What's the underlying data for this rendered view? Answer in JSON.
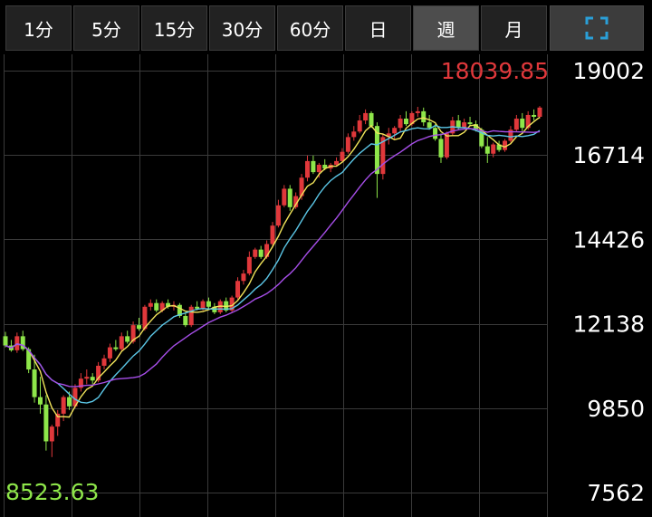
{
  "tabs": [
    {
      "label": "1分",
      "active": false
    },
    {
      "label": "5分",
      "active": false
    },
    {
      "label": "15分",
      "active": false
    },
    {
      "label": "30分",
      "active": false
    },
    {
      "label": "60分",
      "active": false
    },
    {
      "label": "日",
      "active": false
    },
    {
      "label": "週",
      "active": true
    },
    {
      "label": "月",
      "active": false
    }
  ],
  "fullscreen_icon": "expand-icon",
  "colors": {
    "up": "#e0383b",
    "down": "#8ee64a",
    "ma_short": "#f2e45a",
    "ma_mid": "#5bc6e6",
    "ma_long": "#a64ee8",
    "grid": "#3a3a3a",
    "axis_text": "#ffffff",
    "max_label": "#e0383b",
    "min_label": "#8ee64a",
    "active_tab": "#4d4d4d"
  },
  "chart_data": {
    "type": "candlestick",
    "period": "週",
    "y_ticks": [
      "19002",
      "16714",
      "14426",
      "12138",
      "9850",
      "7562"
    ],
    "ylim": [
      7562,
      19002
    ],
    "high_label": "18039.85",
    "low_label": "8523.63",
    "grid": true,
    "moving_averages": [
      "short",
      "mid",
      "long"
    ],
    "candles": [
      [
        11800,
        11920,
        11500,
        11550
      ],
      [
        11550,
        11700,
        11380,
        11420
      ],
      [
        11420,
        11900,
        11350,
        11800
      ],
      [
        11800,
        11950,
        11400,
        11450
      ],
      [
        11450,
        11500,
        10800,
        10900
      ],
      [
        10900,
        11300,
        10000,
        10150
      ],
      [
        10150,
        10700,
        9700,
        9950
      ],
      [
        9950,
        10200,
        8700,
        8950
      ],
      [
        8950,
        9400,
        8524,
        9350
      ],
      [
        9350,
        9800,
        9100,
        9700
      ],
      [
        9700,
        10200,
        9500,
        10150
      ],
      [
        10150,
        10300,
        9800,
        9900
      ],
      [
        9900,
        10500,
        9850,
        10400
      ],
      [
        10400,
        10800,
        10300,
        10650
      ],
      [
        10650,
        10900,
        10500,
        10700
      ],
      [
        10700,
        10800,
        10500,
        10600
      ],
      [
        10600,
        11100,
        10550,
        11000
      ],
      [
        11000,
        11300,
        10900,
        11200
      ],
      [
        11200,
        11600,
        11100,
        11500
      ],
      [
        11500,
        11700,
        11400,
        11450
      ],
      [
        11450,
        11900,
        11400,
        11800
      ],
      [
        11800,
        11950,
        11600,
        11650
      ],
      [
        11650,
        12200,
        11600,
        12100
      ],
      [
        12100,
        12300,
        11950,
        12000
      ],
      [
        12000,
        12650,
        11950,
        12600
      ],
      [
        12600,
        12800,
        12500,
        12700
      ],
      [
        12700,
        12800,
        12450,
        12500
      ],
      [
        12500,
        12750,
        12450,
        12700
      ],
      [
        12700,
        12800,
        12550,
        12600
      ],
      [
        12600,
        12750,
        12500,
        12650
      ],
      [
        12650,
        12700,
        12300,
        12350
      ],
      [
        12350,
        12450,
        12050,
        12100
      ],
      [
        12100,
        12650,
        12050,
        12600
      ],
      [
        12600,
        12750,
        12500,
        12550
      ],
      [
        12550,
        12800,
        12500,
        12750
      ],
      [
        12750,
        12850,
        12550,
        12600
      ],
      [
        12600,
        12700,
        12400,
        12450
      ],
      [
        12450,
        12800,
        12400,
        12750
      ],
      [
        12750,
        12850,
        12450,
        12500
      ],
      [
        12500,
        12900,
        12450,
        12850
      ],
      [
        12850,
        13400,
        12800,
        13300
      ],
      [
        13300,
        13600,
        13200,
        13500
      ],
      [
        13500,
        14100,
        13450,
        13950
      ],
      [
        13950,
        14200,
        13900,
        14150
      ],
      [
        14150,
        14250,
        13900,
        13950
      ],
      [
        13950,
        14400,
        13900,
        14300
      ],
      [
        14300,
        14900,
        14200,
        14800
      ],
      [
        14800,
        15500,
        14750,
        15350
      ],
      [
        15350,
        15900,
        15300,
        15800
      ],
      [
        15800,
        15900,
        15200,
        15300
      ],
      [
        15300,
        15700,
        15250,
        15600
      ],
      [
        15600,
        16200,
        15500,
        16100
      ],
      [
        16100,
        16700,
        16000,
        16550
      ],
      [
        16550,
        16700,
        16200,
        16250
      ],
      [
        16250,
        16500,
        16100,
        16450
      ],
      [
        16450,
        16600,
        16300,
        16350
      ],
      [
        16350,
        16500,
        16250,
        16450
      ],
      [
        16450,
        16650,
        16400,
        16550
      ],
      [
        16550,
        16900,
        16500,
        16800
      ],
      [
        16800,
        17300,
        16750,
        17200
      ],
      [
        17200,
        17500,
        17100,
        17350
      ],
      [
        17350,
        17800,
        17300,
        17650
      ],
      [
        17650,
        17950,
        17550,
        17850
      ],
      [
        17850,
        17900,
        17450,
        17500
      ],
      [
        17500,
        17600,
        15550,
        16200
      ],
      [
        16200,
        17300,
        16050,
        17200
      ],
      [
        17200,
        17450,
        17000,
        17300
      ],
      [
        17300,
        17500,
        17150,
        17450
      ],
      [
        17450,
        17800,
        17350,
        17700
      ],
      [
        17700,
        17900,
        17500,
        17550
      ],
      [
        17550,
        17900,
        17500,
        17850
      ],
      [
        17850,
        18020,
        17750,
        17900
      ],
      [
        17900,
        18000,
        17500,
        17600
      ],
      [
        17600,
        17800,
        17400,
        17450
      ],
      [
        17450,
        17550,
        17100,
        17150
      ],
      [
        17150,
        17300,
        16500,
        16650
      ],
      [
        16650,
        17350,
        16600,
        17300
      ],
      [
        17300,
        17750,
        17250,
        17650
      ],
      [
        17650,
        17800,
        17400,
        17450
      ],
      [
        17450,
        17700,
        17400,
        17600
      ],
      [
        17600,
        17750,
        17500,
        17550
      ],
      [
        17550,
        17650,
        17350,
        17400
      ],
      [
        17400,
        17450,
        16900,
        16950
      ],
      [
        16950,
        17200,
        16500,
        16750
      ],
      [
        16750,
        17050,
        16650,
        17000
      ],
      [
        17000,
        17100,
        16800,
        16850
      ],
      [
        16850,
        17150,
        16800,
        17100
      ],
      [
        17100,
        17500,
        17050,
        17400
      ],
      [
        17400,
        17800,
        17350,
        17700
      ],
      [
        17700,
        17850,
        17350,
        17450
      ],
      [
        17450,
        17900,
        17400,
        17800
      ],
      [
        17800,
        17950,
        17650,
        17750
      ],
      [
        17750,
        18040,
        17700,
        18000
      ]
    ]
  }
}
